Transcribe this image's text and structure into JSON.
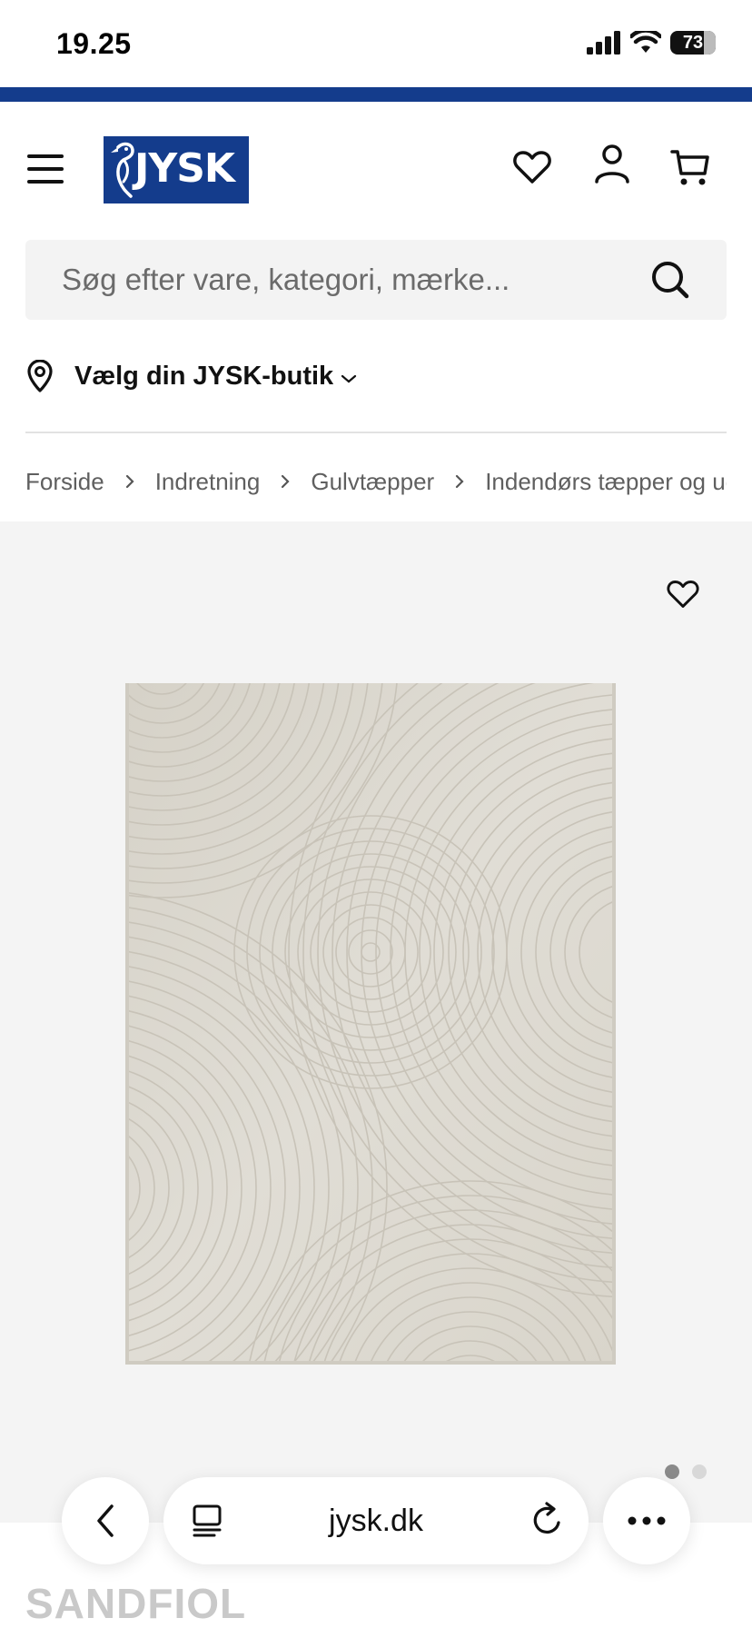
{
  "status_bar": {
    "time": "19.25",
    "battery": "73"
  },
  "header": {
    "logo_text": "JYSK",
    "icons": [
      "menu-icon",
      "heart-icon",
      "user-icon",
      "cart-icon"
    ]
  },
  "search": {
    "placeholder": "Søg efter vare, kategori, mærke..."
  },
  "store": {
    "label": "Vælg din JYSK-butik"
  },
  "breadcrumb": {
    "items": [
      "Forside",
      "Indretning",
      "Gulvtæpper",
      "Indendørs tæpper og uden"
    ]
  },
  "gallery": {
    "image_count": 2,
    "active_index": 0
  },
  "product": {
    "title": "SANDFIOL"
  },
  "browser": {
    "url": "jysk.dk"
  },
  "colors": {
    "brand_blue": "#143c8c",
    "gallery_bg": "#f4f4f4",
    "rug": "#dcd8cf"
  }
}
